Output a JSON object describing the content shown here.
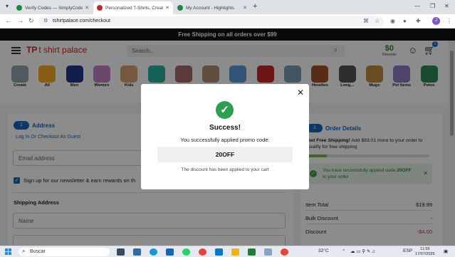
{
  "browser": {
    "tabs": [
      {
        "title": "Verify Codes — SimplyCodes",
        "favicon_color": "#1b8a3a",
        "active": false
      },
      {
        "title": "Personalized T-Shirts, Create O...",
        "favicon_color": "#c62828",
        "active": true
      },
      {
        "title": "My Account - Highlights",
        "favicon_color": "#1b8a3a",
        "active": false
      }
    ],
    "new_tab": "+",
    "url": "tshirtpalace.com/checkout",
    "profile_initial": "J"
  },
  "site": {
    "promo_banner": "Free Shipping on all orders over $99",
    "logo": {
      "mark": "TP",
      "name": "t shirt palace"
    },
    "search_placeholder": "Search...",
    "rewards": {
      "amount": "$0",
      "label": "Rewards"
    },
    "cart_count": "1",
    "categories": [
      {
        "label": "Create",
        "color": "#90a4ae"
      },
      {
        "label": "All",
        "color": "#f9a825"
      },
      {
        "label": "Men",
        "color": "#1e3a8a"
      },
      {
        "label": "Women",
        "color": "#c084c4"
      },
      {
        "label": "Kids",
        "color": "#d4a373"
      },
      {
        "label": "",
        "color": "#2bb3a0"
      },
      {
        "label": "",
        "color": "#a56a6a"
      },
      {
        "label": "",
        "color": "#b08d6e"
      },
      {
        "label": "",
        "color": "#5b9bd5"
      },
      {
        "label": "",
        "color": "#c62828"
      },
      {
        "label": "",
        "color": "#7a9bb0"
      },
      {
        "label": "Hoodies",
        "color": "#a0522d"
      },
      {
        "label": "Long...",
        "color": "#555555"
      },
      {
        "label": "Mugs",
        "color": "#c08a3e"
      },
      {
        "label": "Pet Items",
        "color": "#8e7cc3"
      },
      {
        "label": "Polos",
        "color": "#2e8b57"
      }
    ]
  },
  "checkout": {
    "address": {
      "badge": "1",
      "title": "Address",
      "login_link": "Log In Or Checkout As Guest",
      "email_placeholder": "Email address",
      "newsletter": "Sign up for our newsletter & earn rewards on th",
      "shipping_title": "Shipping Address",
      "name_placeholder": "Name"
    },
    "order": {
      "badge": "2",
      "title": "Order Details",
      "free_shipping_msg_prefix": "Get Free Shipping!",
      "free_shipping_msg": " Add $83.01 more to your order to qualify for free shipping",
      "progress_fraction": 0.16,
      "applied_msg_prefix": "You have successfully applied code ",
      "applied_code": "20OFF",
      "applied_msg_suffix": " to your order",
      "rows": [
        {
          "label": "Item Total",
          "value": "$19.99",
          "color": "#222222"
        },
        {
          "label": "Bulk Discount",
          "value": "-",
          "color": "#222222"
        },
        {
          "label": "Discount",
          "value": "-$4.00",
          "color": "#d32f2f"
        }
      ]
    }
  },
  "modal": {
    "heading": "Success!",
    "message": "You successfully applied promo code:",
    "code": "20OFF",
    "note": "The discount has been applied to your cart"
  },
  "taskbar": {
    "search_text": "Buscar",
    "weather": "32°C",
    "lang": "ESP",
    "time": "11:59",
    "date": "17/07/2025"
  }
}
